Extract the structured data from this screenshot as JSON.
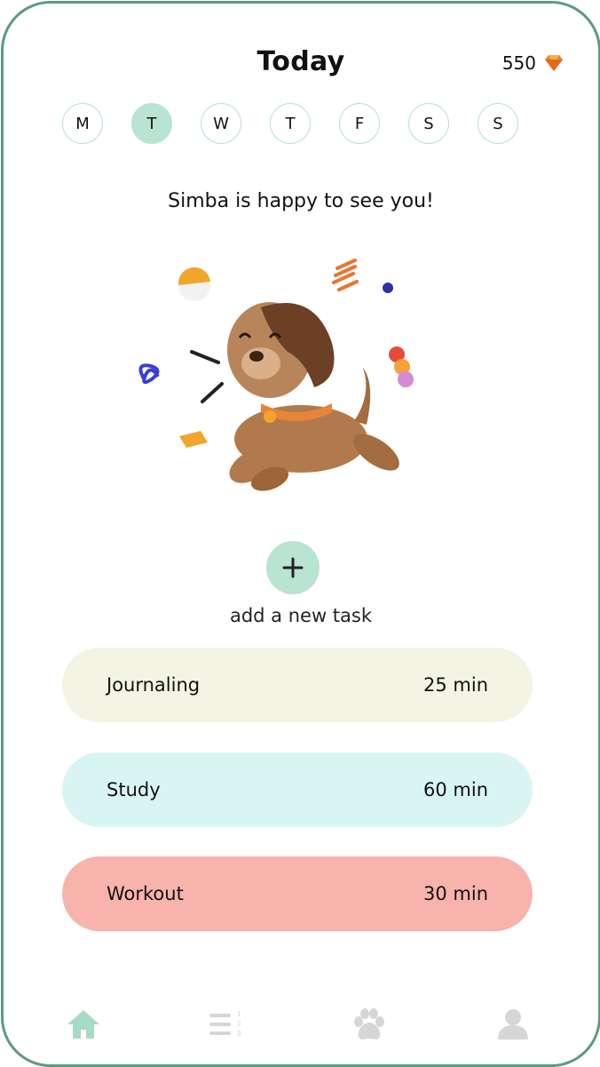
{
  "header": {
    "title": "Today",
    "coins": "550",
    "coin_icon": "gem-icon"
  },
  "week": {
    "days": [
      "M",
      "T",
      "W",
      "T",
      "F",
      "S",
      "S"
    ],
    "selected_index": 1
  },
  "pet": {
    "greeting": "Simba is happy to see you!",
    "icon": "puppy-illustration"
  },
  "add_task": {
    "label": "add a new task",
    "icon": "plus-icon"
  },
  "tasks": [
    {
      "name": "Journaling",
      "duration": "25 min",
      "color": "#f4f4e4"
    },
    {
      "name": "Study",
      "duration": "60 min",
      "color": "#d8f5f4"
    },
    {
      "name": "Workout",
      "duration": "30 min",
      "color": "#f8b3ac"
    }
  ],
  "nav": {
    "items": [
      "home-icon",
      "ranked-list-icon",
      "paw-icon",
      "profile-icon"
    ],
    "active_index": 0
  },
  "colors": {
    "accent": "#b9e3d2",
    "frame": "#5e9a7e",
    "nav_active": "#a8dbc6",
    "nav_inactive": "#d6d6d6"
  }
}
